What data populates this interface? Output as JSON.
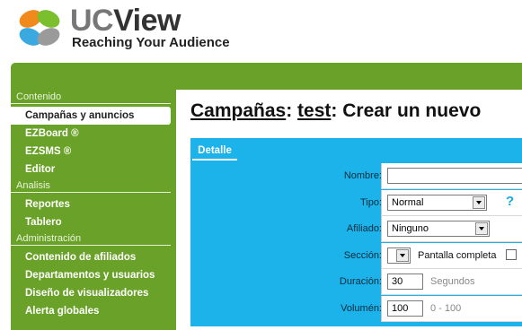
{
  "brand": {
    "name_prefix": "UC",
    "name_suffix": "View",
    "tagline": "Reaching Your Audience",
    "colors": {
      "green": "#6aa128",
      "blue": "#1cb2ea",
      "orange": "#f08a1c",
      "leaf_green": "#7bbf2e",
      "leaf_blue": "#39a9e0",
      "leaf_gray": "#9a9a9a"
    }
  },
  "sidebar": {
    "sections": [
      {
        "title": "Contenido",
        "items": [
          "Campañas y anuncios",
          "EZBoard ®",
          "EZSMS ®",
          "Editor"
        ]
      },
      {
        "title": "Analisis",
        "items": [
          "Reportes",
          "Tablero"
        ]
      },
      {
        "title": "Administración",
        "items": [
          "Contenido de afiliados",
          "Departamentos y usuarios",
          "Diseño de visualizadores",
          "Alerta globales"
        ]
      }
    ]
  },
  "title": {
    "part1": "Campañas",
    "sep1": ": ",
    "part2": "test",
    "sep2": ": ",
    "part3": "Crear un nuevo"
  },
  "tab": {
    "label": "Detalle"
  },
  "form": {
    "nombre": {
      "label": "Nombre:",
      "value": ""
    },
    "tipo": {
      "label": "Tipo:",
      "value": "Normal",
      "help": "?"
    },
    "afiliado": {
      "label": "Afiliado:",
      "value": "Ninguno"
    },
    "seccion": {
      "label": "Sección:",
      "value": "",
      "checkbox_label": "Pantalla completa"
    },
    "duracion": {
      "label": "Duración:",
      "value": "30",
      "unit": "Segundos"
    },
    "volumen": {
      "label": "Volumén:",
      "value": "100",
      "range": "0 - 100"
    }
  }
}
